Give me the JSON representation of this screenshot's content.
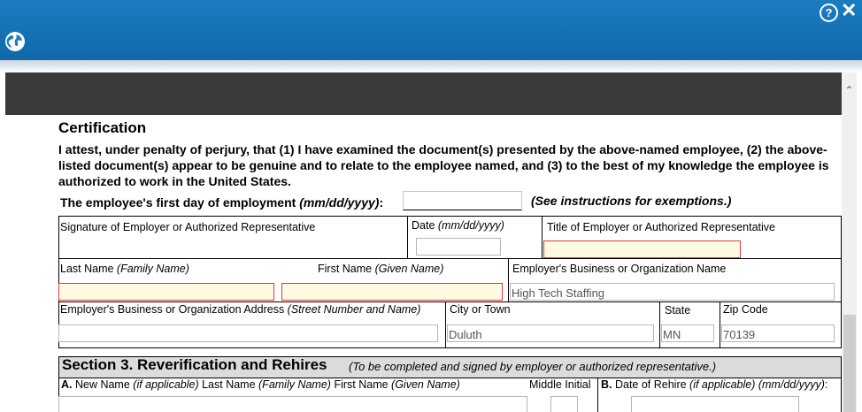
{
  "window": {
    "help_icon": "?",
    "close_icon": "✕",
    "globe_icon": "globe-icon"
  },
  "certification": {
    "heading": "Certification",
    "attestation": "I attest, under penalty of perjury, that (1) I have examined the document(s) presented by the above-named employee, (2) the above-listed document(s) appear to be genuine and to relate to the employee named, and (3) to the best of my knowledge the employee is authorized to work in the United States.",
    "first_day_label": "The employee's first day of employment ",
    "first_day_format": "(mm/dd/yyyy)",
    "first_day_colon": ":",
    "first_day_value": "",
    "see_instructions": "(See instructions for exemptions.)"
  },
  "fields": {
    "signature_label": "Signature of Employer or Authorized Representative",
    "date_label": "Date ",
    "date_format": "(mm/dd/yyyy)",
    "date_value": "",
    "title_label": "Title of Employer or Authorized Representative",
    "title_value": "",
    "last_name_label": "Last Name ",
    "last_name_hint": "(Family Name)",
    "last_name_value": "",
    "first_name_label": "First Name ",
    "first_name_hint": "(Given Name)",
    "first_name_value": "",
    "org_name_label": "Employer's Business or Organization Name",
    "org_name_value": "High Tech Staffing",
    "address_label": "Employer's Business or Organization Address ",
    "address_hint": "(Street Number and Name)",
    "address_value": "",
    "city_label": "City or Town",
    "city_value": "Duluth",
    "state_label": "State",
    "state_value": "MN",
    "zip_label": "Zip Code",
    "zip_value": "70139"
  },
  "section3": {
    "title": "Section 3. Reverification and Rehires",
    "subtitle": "(To be completed and signed by employer or authorized representative.)",
    "a_prefix": "A.",
    "a_label": " New Name ",
    "a_hint": "(if applicable)",
    "a_last": " Last Name ",
    "a_last_hint": "(Family Name)",
    "a_first": "  First Name ",
    "a_first_hint": "(Given Name)",
    "middle_initial_label": "Middle Initial",
    "b_prefix": "B.",
    "b_label": " Date of Rehire ",
    "b_hint": "(if applicable) (mm/dd/yyyy)",
    "b_colon": ":"
  },
  "colors": {
    "header_blue": "#1a7dc0",
    "required_fill": "#fffbe2",
    "required_border": "#d83c3c"
  }
}
